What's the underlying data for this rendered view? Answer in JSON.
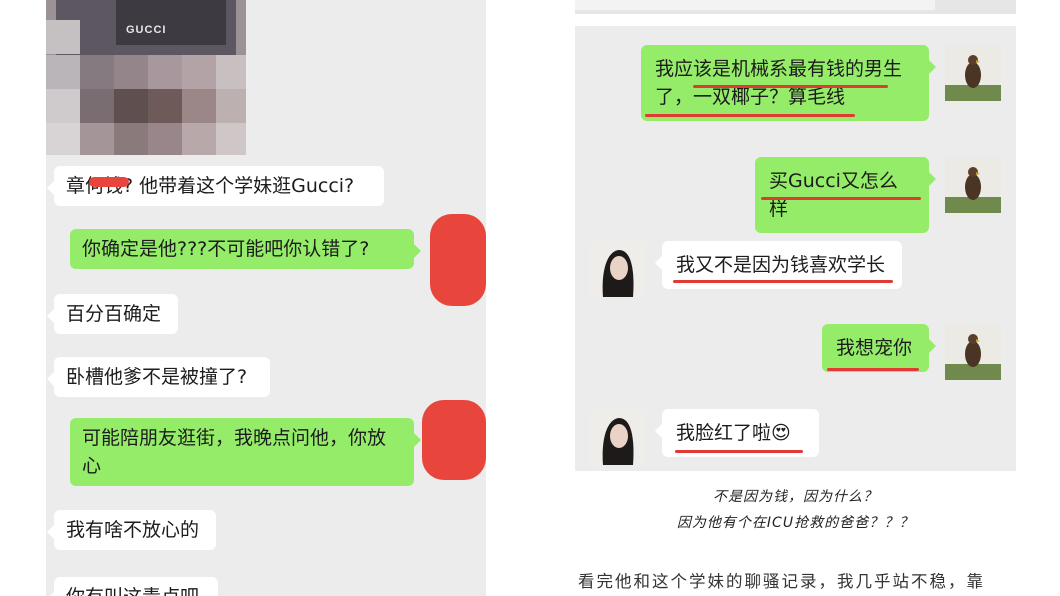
{
  "left_chat": {
    "image": {
      "store_sign": "GUCCI"
    },
    "messages": [
      {
        "text": "章何钱? 他带着这个学妹逛Gucci?"
      },
      {
        "text": "你确定是他???不可能吧你认错了?"
      },
      {
        "text": "百分百确定"
      },
      {
        "text": "卧槽他爹不是被撞了?"
      },
      {
        "text": "可能陪朋友逛街，我晚点问他，你放心"
      },
      {
        "text": "我有啥不放心的"
      },
      {
        "text": "你有叫这青卢吧"
      }
    ]
  },
  "right_chat": {
    "messages": [
      {
        "text": "我应该是机械系最有钱的男生了，一双椰子？算毛线"
      },
      {
        "text": "买Gucci又怎么样"
      },
      {
        "text": "我又不是因为钱喜欢学长"
      },
      {
        "text": "我想宠你"
      },
      {
        "text": "我脸红了啦"
      }
    ],
    "emoji": "😍"
  },
  "captions": {
    "line1": "不是因为钱，因为什么？",
    "line2": "因为他有个在ICU抢救的爸爸？？？"
  },
  "article_text": "看完他和这个学妹的聊骚记录，我几乎站不稳，靠",
  "colors": {
    "wechat_green": "#95ec69",
    "chat_bg": "#ececec",
    "annotation_red": "#e13a32"
  }
}
